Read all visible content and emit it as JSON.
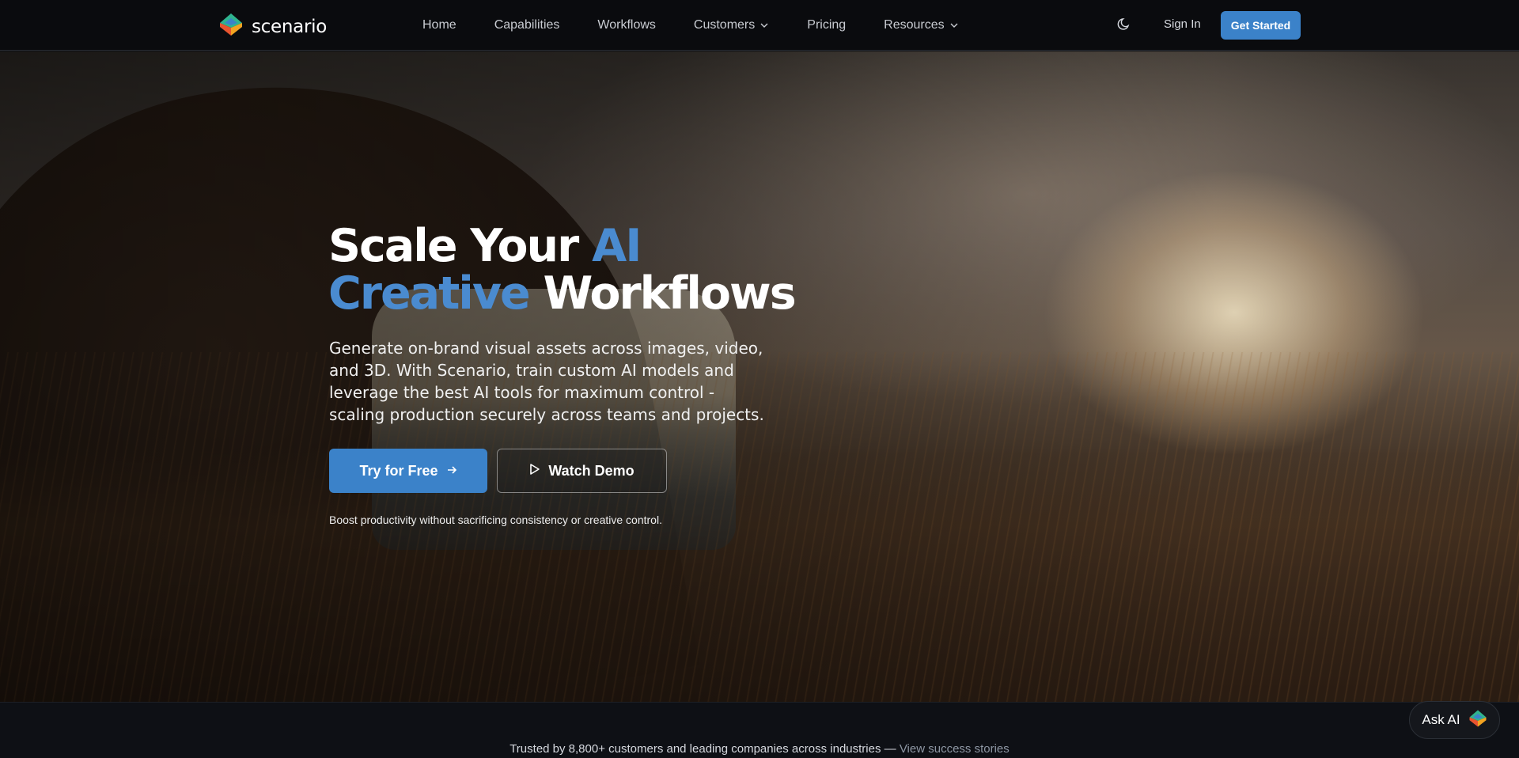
{
  "nav": {
    "brand": "scenario",
    "links": [
      {
        "label": "Home"
      },
      {
        "label": "Capabilities"
      },
      {
        "label": "Workflows"
      },
      {
        "label": "Customers",
        "dropdown": true
      },
      {
        "label": "Pricing"
      },
      {
        "label": "Resources",
        "dropdown": true
      }
    ],
    "theme_icon": "moon-icon",
    "sign_in": "Sign In",
    "get_started": "Get Started"
  },
  "hero": {
    "title_line1_white": "Scale Your ",
    "title_line1_accent": "AI",
    "title_line2_accent": "Creative",
    "title_line2_white": " Workflows",
    "description": "Generate on-brand visual assets across images, video, and 3D. With Scenario, train custom AI models and leverage the best AI tools for maximum control - scaling production securely across teams and projects.",
    "try_button": "Try for Free",
    "demo_button": "Watch Demo",
    "note": "Boost productivity without sacrificing consistency or creative control."
  },
  "trusted": {
    "text": "Trusted by 8,800+ customers and leading companies across industries — ",
    "link": "View success stories"
  },
  "ask_ai": {
    "label": "Ask AI"
  },
  "colors": {
    "accent": "#3b82c9",
    "title_accent": "#4a8bd0",
    "nav_bg": "#0a0b0e"
  }
}
